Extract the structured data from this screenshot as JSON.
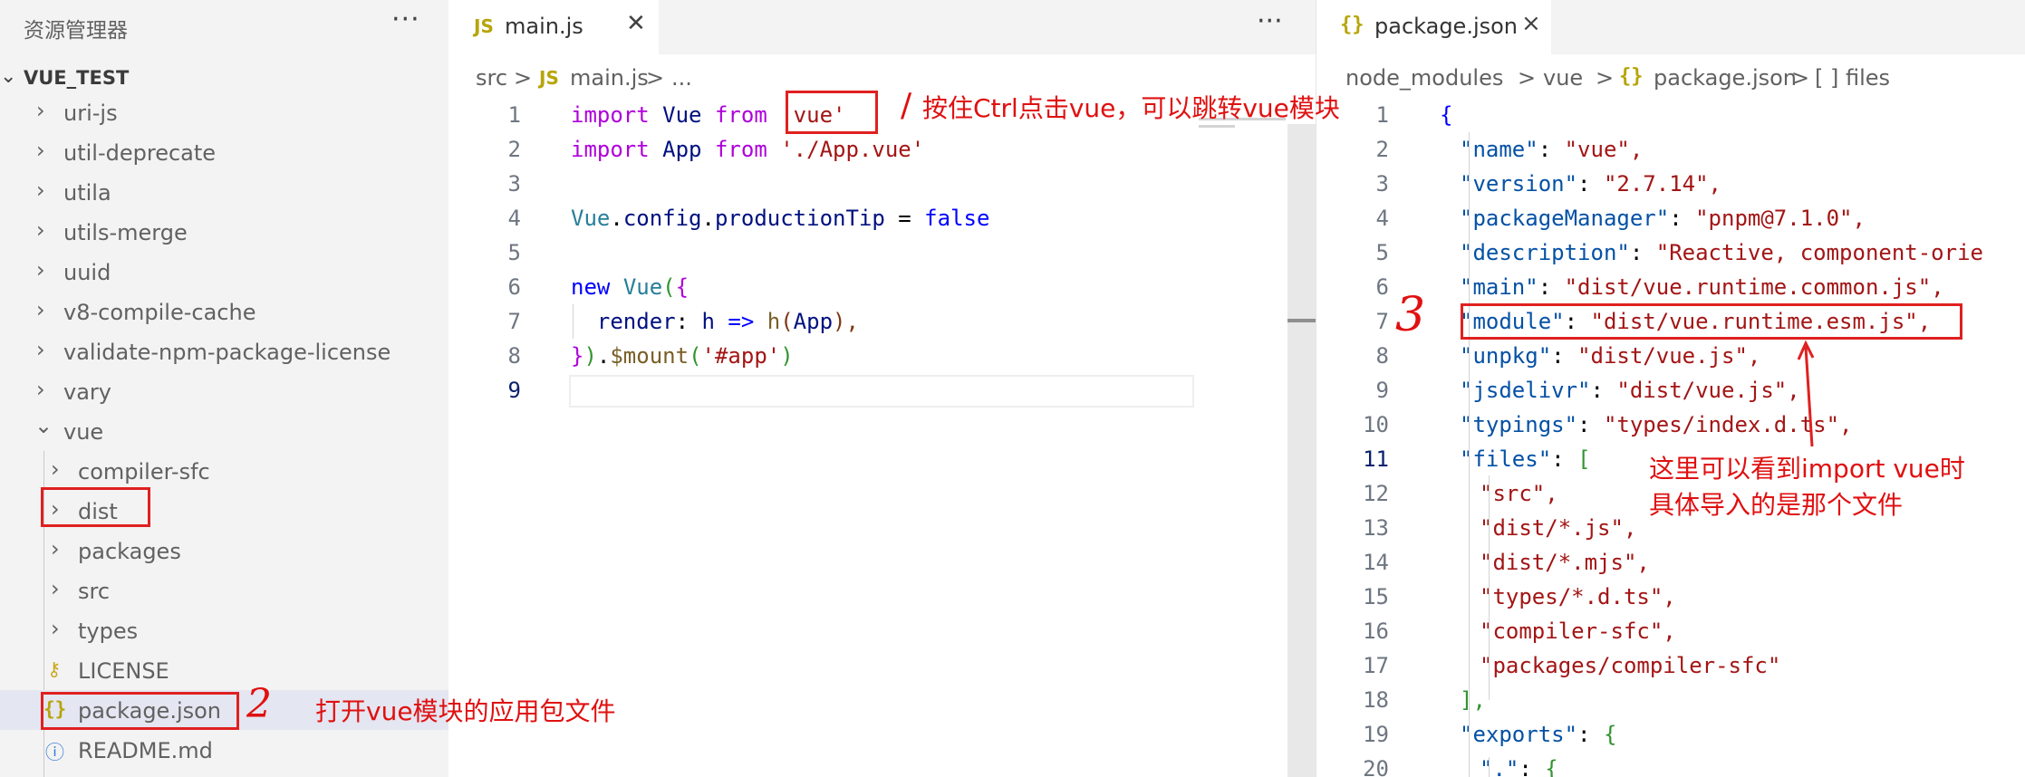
{
  "explorer": {
    "title": "资源管理器",
    "more": "···",
    "root": "VUE_TEST",
    "items": [
      {
        "label": "uri-js"
      },
      {
        "label": "util-deprecate"
      },
      {
        "label": "utila"
      },
      {
        "label": "utils-merge"
      },
      {
        "label": "uuid"
      },
      {
        "label": "v8-compile-cache"
      },
      {
        "label": "validate-npm-package-license"
      },
      {
        "label": "vary"
      },
      {
        "label": "vue"
      },
      {
        "label": "compiler-sfc"
      },
      {
        "label": "dist"
      },
      {
        "label": "packages"
      },
      {
        "label": "src"
      },
      {
        "label": "types"
      },
      {
        "label": "LICENSE"
      },
      {
        "label": "package.json"
      },
      {
        "label": "README.md"
      }
    ]
  },
  "editor1": {
    "tab": {
      "icon": "JS",
      "name": "main.js"
    },
    "more": "···",
    "breadcrumb": {
      "folder": "src",
      "sep": ">",
      "icon": "JS",
      "file": "main.js",
      "tail": "..."
    },
    "line_numbers": [
      "1",
      "2",
      "3",
      "4",
      "5",
      "6",
      "7",
      "8",
      "9"
    ],
    "code": {
      "l1": {
        "kw1": "import",
        "id": "Vue",
        "kw2": "from",
        "str": "'vue'"
      },
      "l2": {
        "kw1": "import",
        "id": "App",
        "kw2": "from",
        "str": "'./App.vue'"
      },
      "l4": {
        "a": "Vue",
        "b": ".",
        "c": "config",
        "d": ".",
        "e": "productionTip",
        "f": " = ",
        "g": "false"
      },
      "l6": {
        "kw": "new",
        "cls": "Vue",
        "p1": "(",
        "p2": "{"
      },
      "l7": {
        "prop": "render",
        "colon": ": ",
        "h": "h",
        "arrow": " => ",
        "fn": "h",
        "p1": "(",
        "arg": "App",
        "p2": "),"
      },
      "l8": {
        "b1": "}",
        "p1": ")",
        "dot": ".",
        "fn": "$mount",
        "p2": "(",
        "str": "'#app'",
        "p3": ")"
      }
    }
  },
  "editor2": {
    "tab": {
      "icon": "{}",
      "name": "package.json",
      "close": "×"
    },
    "breadcrumb": {
      "a": "node_modules",
      "b": "vue",
      "icon": "{}",
      "c": "package.json",
      "d": "[ ] files",
      "sep": ">"
    },
    "line_numbers": [
      "1",
      "2",
      "3",
      "4",
      "5",
      "6",
      "7",
      "8",
      "9",
      "10",
      "11",
      "12",
      "13",
      "14",
      "15",
      "16",
      "17",
      "18",
      "19",
      "20"
    ],
    "lines": [
      {
        "key": "",
        "val": "{"
      },
      {
        "key": "\"name\"",
        "val": "\"vue\","
      },
      {
        "key": "\"version\"",
        "val": "\"2.7.14\","
      },
      {
        "key": "\"packageManager\"",
        "val": "\"pnpm@7.1.0\","
      },
      {
        "key": "\"description\"",
        "val": "\"Reactive, component-orie"
      },
      {
        "key": "\"main\"",
        "val": "\"dist/vue.runtime.common.js\","
      },
      {
        "key": "\"module\"",
        "val": "\"dist/vue.runtime.esm.js\","
      },
      {
        "key": "\"unpkg\"",
        "val": "\"dist/vue.js\","
      },
      {
        "key": "\"jsdelivr\"",
        "val": "\"dist/vue.js\","
      },
      {
        "key": "\"typings\"",
        "val": "\"types/index.d.ts\","
      },
      {
        "key": "\"files\"",
        "val": "["
      },
      {
        "key": "",
        "val": "\"src\","
      },
      {
        "key": "",
        "val": "\"dist/*.js\","
      },
      {
        "key": "",
        "val": "\"dist/*.mjs\","
      },
      {
        "key": "",
        "val": "\"types/*.d.ts\","
      },
      {
        "key": "",
        "val": "\"compiler-sfc\","
      },
      {
        "key": "",
        "val": "\"packages/compiler-sfc\""
      },
      {
        "key": "",
        "val": "],"
      },
      {
        "key": "\"exports\"",
        "val": "{"
      },
      {
        "key": "\".\"",
        "val": "{"
      }
    ]
  },
  "annotations": {
    "a1": "按住Ctrl点击vue，可以跳转vue模块",
    "a2": "打开vue模块的应用包文件",
    "a3_line1": "这里可以看到import vue时",
    "a3_line2": "具体导入的是那个文件",
    "num1": "/",
    "num2": "2",
    "num3": "3"
  },
  "colors": {
    "annotation": "#e02020",
    "keyword": "#0000ff",
    "string": "#a31515",
    "json_key": "#0451a5"
  }
}
